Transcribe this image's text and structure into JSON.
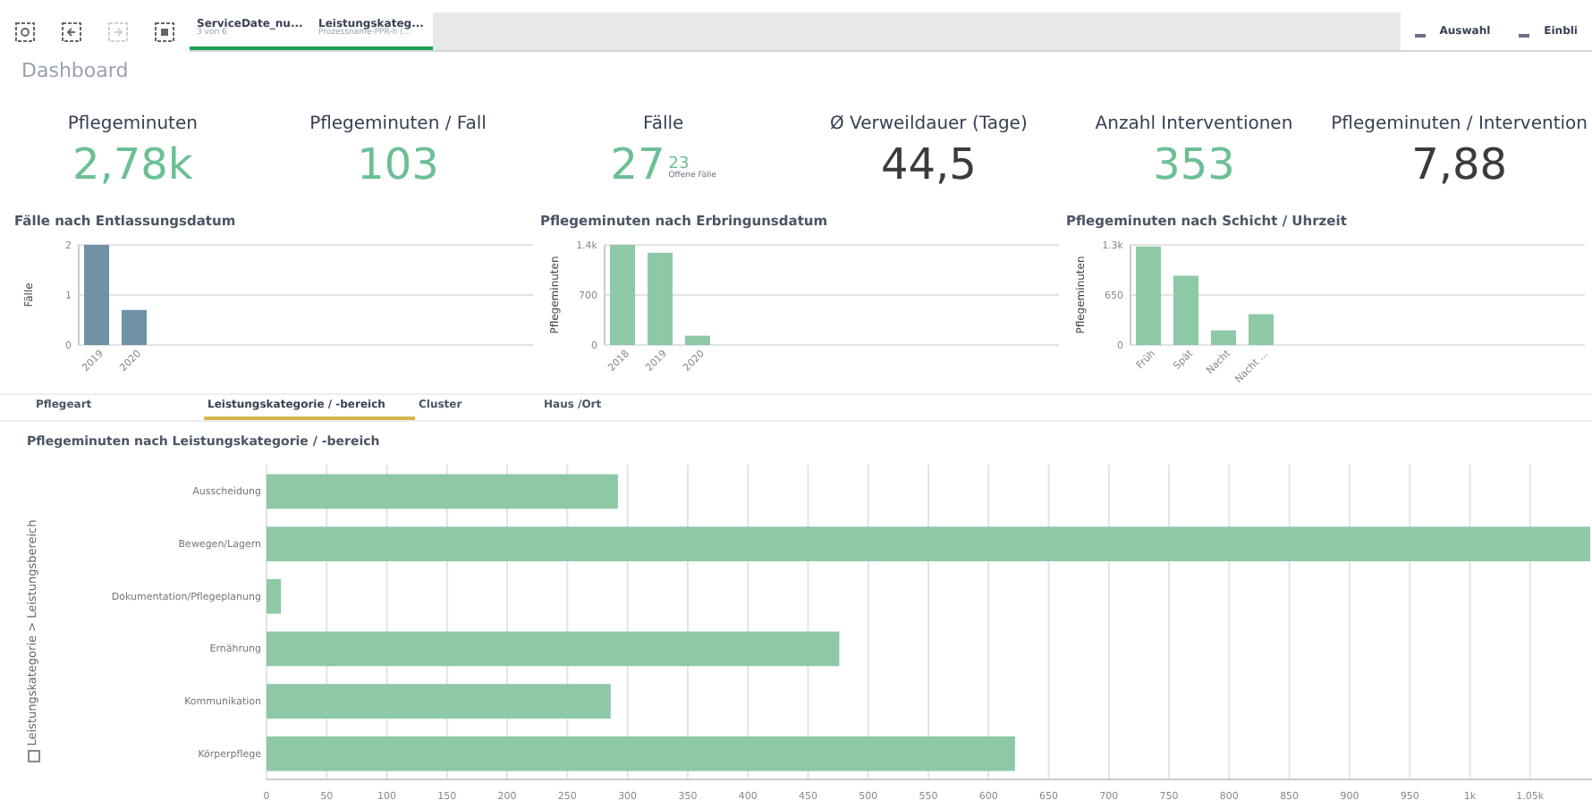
{
  "toolbar": {
    "tools": [
      {
        "disabled": false
      },
      {
        "disabled": false
      },
      {
        "disabled": true
      },
      {
        "disabled": false
      }
    ],
    "selections": [
      {
        "title": "ServiceDate_nu...",
        "subtitle": "3 von 6"
      },
      {
        "title": "Leistungskateg...",
        "subtitle": "Prozessname-PPR-h (..."
      }
    ],
    "actions": [
      {
        "label": "Auswahl"
      },
      {
        "label": "Einbli"
      }
    ]
  },
  "sheet_title": "Dashboard",
  "kpis": [
    {
      "label": "Pflegeminuten",
      "value": "2,78k",
      "color": "#6cbf95"
    },
    {
      "label": "Pflegeminuten / Fall",
      "value": "103",
      "color": "#6cbf95"
    },
    {
      "label": "Fälle",
      "value": "27",
      "color": "#6cbf95",
      "secondary": "23",
      "secondary_label": "Offene Fälle"
    },
    {
      "label": "Ø Verweildauer (Tage)",
      "value": "44,5",
      "color": "#3b3b3b"
    },
    {
      "label": "Anzahl Interventionen",
      "value": "353",
      "color": "#6cbf95"
    },
    {
      "label": "Pflegeminuten / Intervention",
      "value": "7,88",
      "color": "#3b3b3b"
    }
  ],
  "small_charts": [
    {
      "chart_data": {
        "type": "bar",
        "title": "Fälle nach Entlassungsdatum",
        "ylabel": "Fälle",
        "categories": [
          "2019",
          "2020"
        ],
        "series": [
          {
            "color": "#6e91a6",
            "values": [
              2,
              0.7
            ]
          }
        ],
        "grid": true,
        "ylim": [
          0,
          2
        ],
        "yticks": [
          0,
          1,
          2
        ]
      }
    },
    {
      "chart_data": {
        "type": "bar",
        "title": "Pflegeminuten nach Erbringunsdatum",
        "ylabel": "Pflegeminuten",
        "categories": [
          "2018",
          "2019",
          "2020"
        ],
        "series": [
          {
            "color": "#8dc9a6",
            "values": [
              1400,
              1290,
              130
            ]
          }
        ],
        "grid": true,
        "ylim": [
          0,
          1400
        ],
        "yticks": [
          0,
          {
            "value": 700,
            "label": "700"
          },
          {
            "value": 1400,
            "label": "1.4k"
          }
        ]
      }
    },
    {
      "chart_data": {
        "type": "bar",
        "title": "Pflegeminuten nach Schicht / Uhrzeit",
        "ylabel": "Pflegeminuten",
        "categories": [
          "Früh",
          "Spät",
          "Nacht",
          "Nacht ..."
        ],
        "series": [
          {
            "color": "#8dc9a6",
            "values": [
              1280,
              900,
              190,
              400
            ]
          }
        ],
        "grid": true,
        "ylim": [
          0,
          1300
        ],
        "yticks": [
          0,
          {
            "value": 650,
            "label": "650"
          },
          {
            "value": 1300,
            "label": "1.3k"
          }
        ]
      }
    }
  ],
  "tabs": [
    {
      "label": "Pflegeart",
      "selected": false
    },
    {
      "label": "Leistungskategorie / -bereich",
      "selected": true
    },
    {
      "label": "Cluster",
      "selected": false
    },
    {
      "label": "Haus /Ort",
      "selected": false
    }
  ],
  "main_chart": {
    "chart_data": {
      "type": "bar",
      "orientation": "horizontal",
      "title": "Pflegeminuten nach Leistungskategorie / -bereich",
      "ylabel": "Leistungskategorie > Leistungsbereich",
      "categories": [
        "Ausscheidung",
        "Bewegen/Lagern",
        "Dokumentation/Pflegeplanung",
        "Ernährung",
        "Kommunikation",
        "Körperpflege"
      ],
      "series": [
        {
          "color": "#8dc9a6",
          "values": [
            292,
            1100,
            12,
            476,
            286,
            622
          ]
        }
      ],
      "grid": true,
      "xlim": [
        0,
        1100
      ],
      "xticks": [
        0,
        50,
        100,
        150,
        200,
        250,
        300,
        350,
        400,
        450,
        500,
        550,
        600,
        650,
        700,
        750,
        800,
        850,
        900,
        950,
        {
          "value": 1000,
          "label": "1k"
        },
        {
          "value": 1050,
          "label": "1.05k"
        }
      ]
    }
  }
}
